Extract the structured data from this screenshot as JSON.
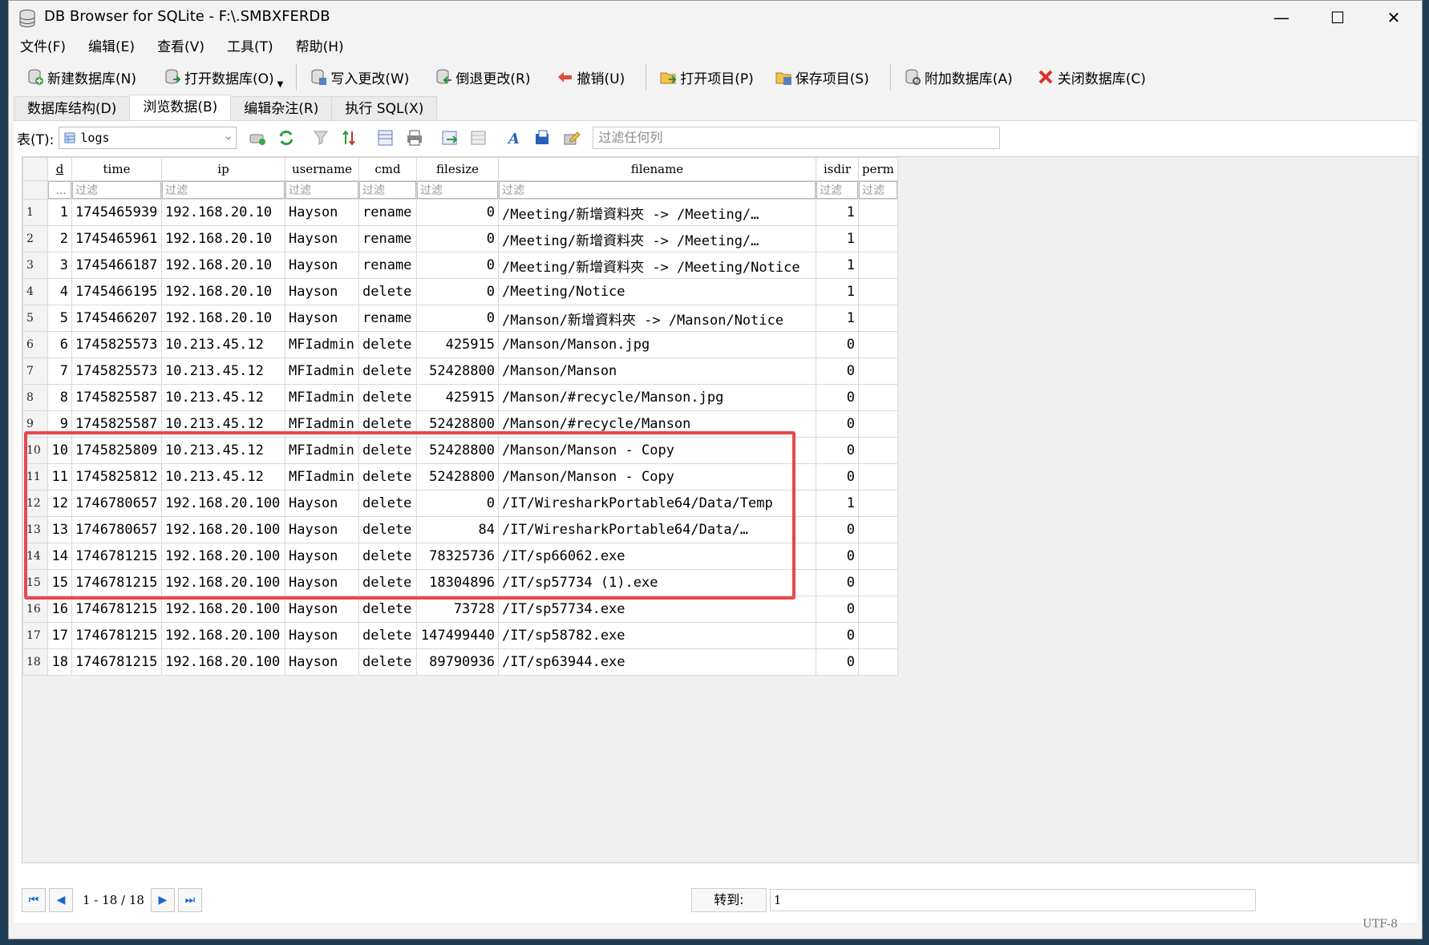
{
  "window": {
    "title": "DB Browser for SQLite - F:\\.SMBXFERDB"
  },
  "controls": {
    "minimize": "—",
    "maximize": "☐",
    "close": "✕"
  },
  "menu": [
    "文件(F)",
    "编辑(E)",
    "查看(V)",
    "工具(T)",
    "帮助(H)"
  ],
  "toolbar": [
    {
      "label": "新建数据库(N)",
      "icon": "new-db-icon"
    },
    {
      "label": "打开数据库(O)",
      "icon": "open-db-icon"
    },
    {
      "label": "写入更改(W)",
      "icon": "write-icon"
    },
    {
      "label": "倒退更改(R)",
      "icon": "revert-icon"
    },
    {
      "label": "撤销(U)",
      "icon": "undo-icon"
    },
    {
      "label": "打开项目(P)",
      "icon": "open-project-icon"
    },
    {
      "label": "保存项目(S)",
      "icon": "save-project-icon"
    },
    {
      "label": "附加数据库(A)",
      "icon": "attach-db-icon"
    },
    {
      "label": "关闭数据库(C)",
      "icon": "close-db-icon"
    }
  ],
  "tabs": [
    "数据库结构(D)",
    "浏览数据(B)",
    "编辑杂注(R)",
    "执行 SQL(X)"
  ],
  "active_tab": 1,
  "table_selector": {
    "label": "表(T):",
    "value": "logs",
    "filter_placeholder": "过滤任何列"
  },
  "grid": {
    "columns": [
      "d",
      "time",
      "ip",
      "username",
      "cmd",
      "filesize",
      "filename",
      "isdir",
      "perm"
    ],
    "filter_placeholder": "过滤",
    "filter_first": "…",
    "rows": [
      [
        "1",
        "1",
        "1745465939",
        "192.168.20.10",
        "Hayson",
        "rename",
        "0",
        "/Meeting/新增資料夾 -> /Meeting/…",
        "1",
        ""
      ],
      [
        "2",
        "2",
        "1745465961",
        "192.168.20.10",
        "Hayson",
        "rename",
        "0",
        "/Meeting/新增資料夾 -> /Meeting/…",
        "1",
        ""
      ],
      [
        "3",
        "3",
        "1745466187",
        "192.168.20.10",
        "Hayson",
        "rename",
        "0",
        "/Meeting/新增資料夾 -> /Meeting/Notice",
        "1",
        ""
      ],
      [
        "4",
        "4",
        "1745466195",
        "192.168.20.10",
        "Hayson",
        "delete",
        "0",
        "/Meeting/Notice",
        "1",
        ""
      ],
      [
        "5",
        "5",
        "1745466207",
        "192.168.20.10",
        "Hayson",
        "rename",
        "0",
        "/Manson/新增資料夾 -> /Manson/Notice",
        "1",
        ""
      ],
      [
        "6",
        "6",
        "1745825573",
        "10.213.45.12",
        "MFIadmin",
        "delete",
        "425915",
        "/Manson/Manson.jpg",
        "0",
        ""
      ],
      [
        "7",
        "7",
        "1745825573",
        "10.213.45.12",
        "MFIadmin",
        "delete",
        "52428800",
        "/Manson/Manson",
        "0",
        ""
      ],
      [
        "8",
        "8",
        "1745825587",
        "10.213.45.12",
        "MFIadmin",
        "delete",
        "425915",
        "/Manson/#recycle/Manson.jpg",
        "0",
        ""
      ],
      [
        "9",
        "9",
        "1745825587",
        "10.213.45.12",
        "MFIadmin",
        "delete",
        "52428800",
        "/Manson/#recycle/Manson",
        "0",
        ""
      ],
      [
        "10",
        "10",
        "1745825809",
        "10.213.45.12",
        "MFIadmin",
        "delete",
        "52428800",
        "/Manson/Manson - Copy",
        "0",
        ""
      ],
      [
        "11",
        "11",
        "1745825812",
        "10.213.45.12",
        "MFIadmin",
        "delete",
        "52428800",
        "/Manson/Manson - Copy",
        "0",
        ""
      ],
      [
        "12",
        "12",
        "1746780657",
        "192.168.20.100",
        "Hayson",
        "delete",
        "0",
        "/IT/WiresharkPortable64/Data/Temp",
        "1",
        ""
      ],
      [
        "13",
        "13",
        "1746780657",
        "192.168.20.100",
        "Hayson",
        "delete",
        "84",
        "/IT/WiresharkPortable64/Data/…",
        "0",
        ""
      ],
      [
        "14",
        "14",
        "1746781215",
        "192.168.20.100",
        "Hayson",
        "delete",
        "78325736",
        "/IT/sp66062.exe",
        "0",
        ""
      ],
      [
        "15",
        "15",
        "1746781215",
        "192.168.20.100",
        "Hayson",
        "delete",
        "18304896",
        "/IT/sp57734 (1).exe",
        "0",
        ""
      ],
      [
        "16",
        "16",
        "1746781215",
        "192.168.20.100",
        "Hayson",
        "delete",
        "73728",
        "/IT/sp57734.exe",
        "0",
        ""
      ],
      [
        "17",
        "17",
        "1746781215",
        "192.168.20.100",
        "Hayson",
        "delete",
        "147499440",
        "/IT/sp58782.exe",
        "0",
        ""
      ],
      [
        "18",
        "18",
        "1746781215",
        "192.168.20.100",
        "Hayson",
        "delete",
        "89790936",
        "/IT/sp63944.exe",
        "0",
        ""
      ]
    ],
    "highlighted_rows": [
      6,
      11
    ],
    "highlight_color": "#e8474f"
  },
  "pager": {
    "range": "1 - 18 / 18",
    "goto_label": "转到:",
    "goto_value": "1"
  },
  "statusbar": {
    "encoding": "UTF-8"
  }
}
